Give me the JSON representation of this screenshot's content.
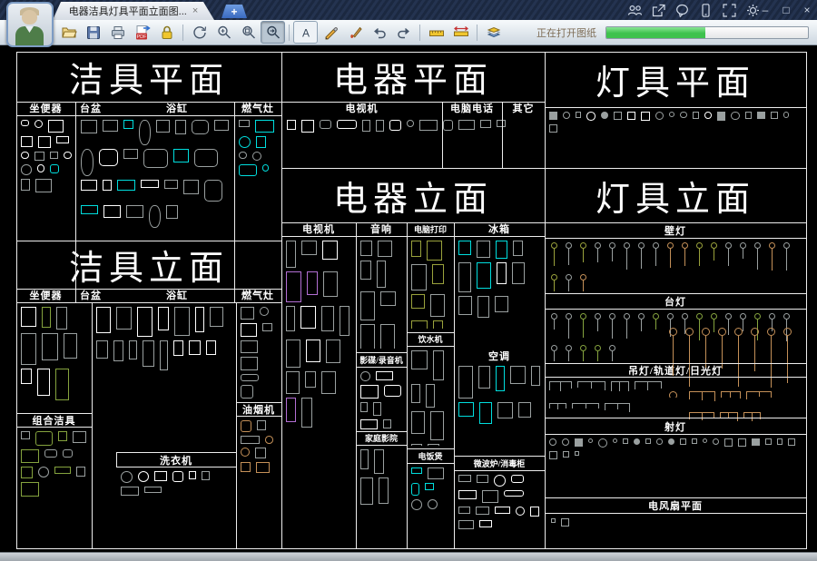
{
  "window": {
    "tab_title": "电器洁具灯具平面立面图...",
    "tab_close_glyph": "×",
    "new_tab_glyph": "+",
    "titlebar_icons": [
      "users",
      "share",
      "chat",
      "phone",
      "fullscreen",
      "settings"
    ],
    "controls": {
      "minimize": "–",
      "maximize": "□",
      "close": "×"
    }
  },
  "toolbar": {
    "icons": [
      "open",
      "save",
      "print",
      "export-pdf",
      "lock",
      "orbit",
      "zoom-in-out",
      "zoom-window",
      "zoom-area",
      "text",
      "pencil",
      "brush",
      "undo",
      "redo",
      "measure",
      "dimension",
      "layers"
    ],
    "active_icon": "zoom-area",
    "status_text": "正在打开图纸",
    "progress_percent": 49
  },
  "palette": {
    "line": "#ededed",
    "white": "#ffffff",
    "gray": "#9aa0a0",
    "cyan": "#00dede",
    "green": "#85a33e",
    "olive": "#9aa23c",
    "tan": "#c49058",
    "purple": "#b36fd4",
    "progress": "#3ec24d",
    "progress_light": "#8ae695"
  },
  "sections": {
    "jieju_plan": {
      "title": "洁具平面",
      "cols": [
        "坐便器",
        "台盆",
        "浴缸",
        "燃气灶"
      ]
    },
    "dianqi_plan": {
      "title": "电器平面",
      "cols": [
        "电视机",
        "电脑电话",
        "其它"
      ]
    },
    "dengju_plan": {
      "title": "灯具平面"
    },
    "jieju_elev": {
      "title": "洁具立面",
      "cols": [
        "坐便器",
        "台盆",
        "浴缸",
        "燃气灶"
      ],
      "combo": "组合洁具",
      "washer": "洗衣机",
      "hood": "油烟机"
    },
    "dianqi_elev": {
      "title": "电器立面",
      "cols": [
        "电视机",
        "音响",
        "电脑打印",
        "冰箱"
      ],
      "vcd": "影碟/录音机",
      "home_theater": "家庭影院",
      "water": "饮水机",
      "rice": "电饭煲",
      "ac": "空调",
      "microwave": "微波炉/消毒柜"
    },
    "dengju_elev": {
      "title": "灯具立面",
      "wall": "壁灯",
      "desk": "台灯",
      "pendant": "吊灯/轨道灯/日光灯",
      "spot": "射灯",
      "fan": "电风扇平面"
    }
  }
}
